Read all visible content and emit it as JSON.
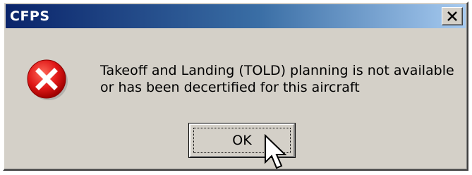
{
  "window": {
    "title": "CFPS",
    "close_label": "Close"
  },
  "message": {
    "line1": "Takeoff and Landing (TOLD) planning is not available",
    "line2": "or has been decertified for this aircraft"
  },
  "buttons": {
    "ok_label": "OK"
  },
  "icons": {
    "error": "error-circle-x-icon",
    "close": "close-x-icon",
    "cursor": "arrow-pointer-icon"
  },
  "colors": {
    "titlebar_start": "#0a246a",
    "titlebar_end": "#a6caf0",
    "dialog_face": "#d4d0c8",
    "error_red": "#e01818"
  }
}
